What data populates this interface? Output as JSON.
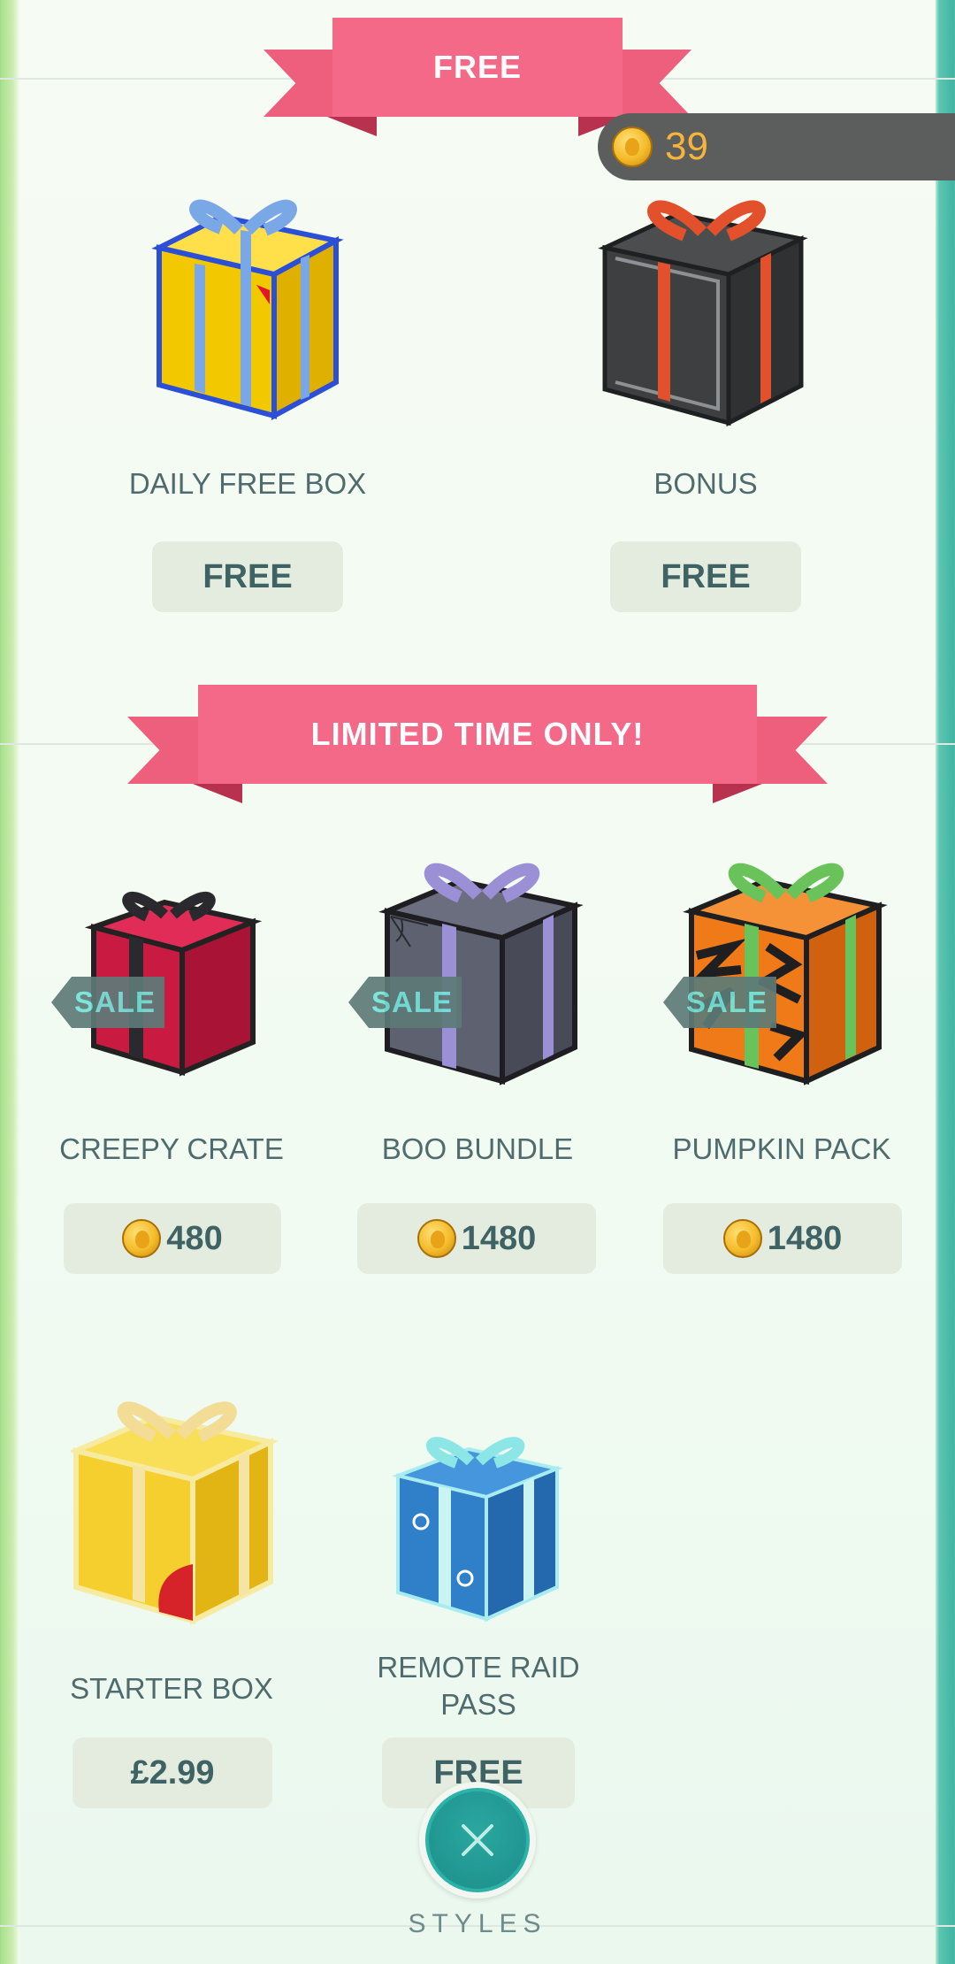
{
  "coins": {
    "count": "39",
    "icon": "pokecoin-icon"
  },
  "sections": {
    "free": {
      "title": "FREE"
    },
    "limited": {
      "title": "LIMITED TIME ONLY!"
    }
  },
  "free_items": [
    {
      "name": "DAILY FREE BOX",
      "price": "FREE",
      "icon": "gift-box-yellow-icon"
    },
    {
      "name": "BONUS",
      "price": "FREE",
      "icon": "gift-box-dark-icon"
    }
  ],
  "limited_items": [
    {
      "name": "CREEPY CRATE",
      "price": "480",
      "tag": "SALE",
      "icon": "gift-box-red-icon"
    },
    {
      "name": "BOO BUNDLE",
      "price": "1480",
      "tag": "SALE",
      "icon": "gift-box-grey-icon"
    },
    {
      "name": "PUMPKIN PACK",
      "price": "1480",
      "tag": "SALE",
      "icon": "gift-box-tiger-icon"
    }
  ],
  "other_items": [
    {
      "name": "STARTER BOX",
      "price": "£2.99",
      "icon": "gift-box-yellow-icon"
    },
    {
      "name": "REMOTE RAID PASS",
      "price": "FREE",
      "icon": "raid-pass-gift-icon"
    }
  ],
  "footer": {
    "label": "STYLES",
    "close_icon": "close-icon"
  },
  "colors": {
    "ribbon": "#f36987",
    "accent_teal": "#1d8e8a",
    "coin_text": "#f7b43a"
  }
}
